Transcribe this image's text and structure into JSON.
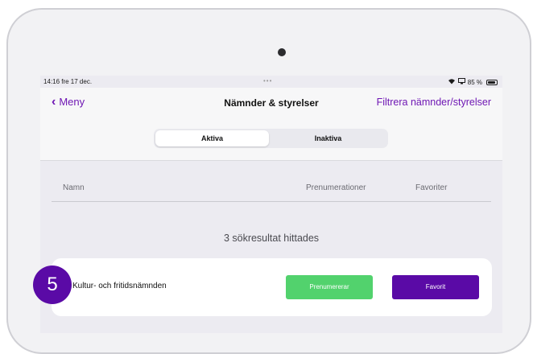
{
  "status_bar": {
    "time_date": "14:16  fre 17 dec.",
    "dots": "•••",
    "battery_text": "85 %",
    "battery_level": 0.85
  },
  "navbar": {
    "back_label": "Meny",
    "title": "Nämnder & styrelser",
    "filter_label": "Filtrera nämnder/styrelser"
  },
  "segments": {
    "active": "Aktiva",
    "inactive": "Inaktiva"
  },
  "table": {
    "columns": [
      "Namn",
      "Prenumerationer",
      "Favoriter"
    ]
  },
  "results_text": "3 sökresultat hittades",
  "rows": [
    {
      "name": "Kultur- och fritidsnämnden",
      "subscribe_label": "Prenumererar",
      "favorite_label": "Favorit"
    }
  ],
  "step_badge": "5",
  "colors": {
    "accent": "#6f17b4",
    "favorite": "#5a0aa6",
    "subscribed": "#52d26d"
  }
}
